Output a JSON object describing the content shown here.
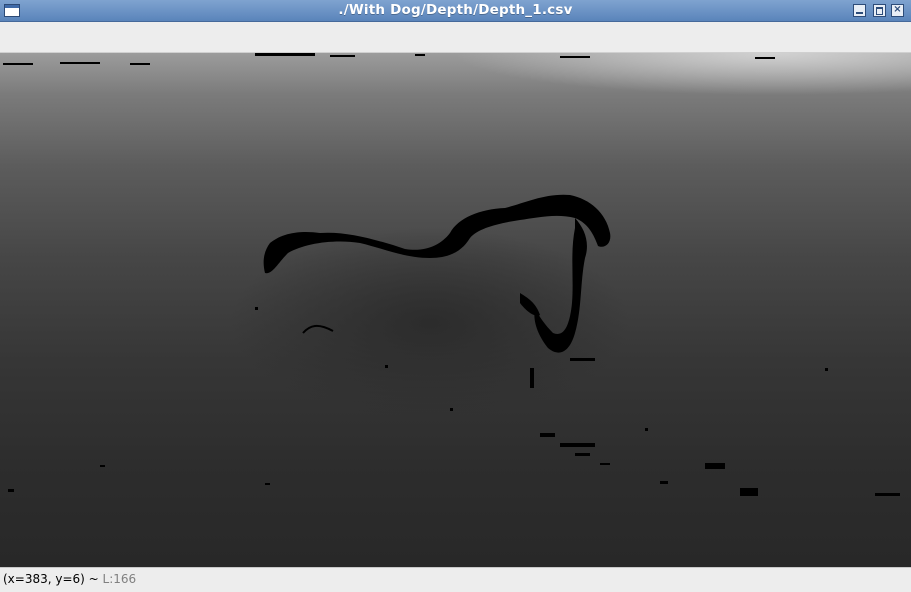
{
  "window": {
    "title": "./With Dog/Depth/Depth_1.csv",
    "icon": "window-menu-icon",
    "controls": [
      "minimize-icon",
      "maximize-icon",
      "close-icon"
    ]
  },
  "image": {
    "description": "depth map"
  },
  "status": {
    "coords": "(x=383, y=6)",
    "separator": " ~ ",
    "level": "L:166"
  }
}
